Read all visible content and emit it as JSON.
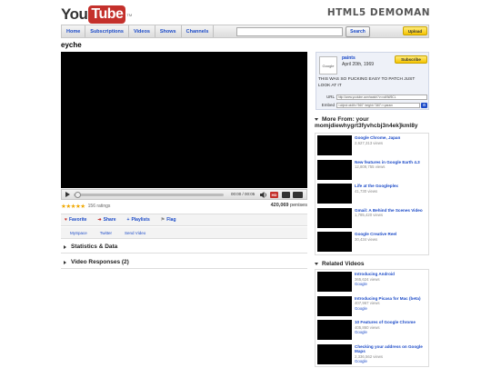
{
  "header": {
    "logo_you": "You",
    "logo_tube": "Tube",
    "logo_tm": "TM",
    "demo_title": "HTML5 DEMOMAN"
  },
  "nav": {
    "items": [
      "Home",
      "Subscriptions",
      "Videos",
      "Shows",
      "Channels"
    ],
    "search_button": "Search",
    "upload_button": "Upload"
  },
  "video": {
    "title": "eyche",
    "time": "00:00 / 00:05",
    "hd_label": "HD",
    "ratings": "156 ratings",
    "stars": "★★★★★",
    "view_count": "420,069",
    "view_suffix": "penises"
  },
  "actions": [
    "Favorite",
    "Share",
    "Playlists",
    "Flag"
  ],
  "share_links": [
    "MySpace",
    "Twitter",
    "Send Video"
  ],
  "sections": [
    "Statistics & Data",
    "Video Responses (2)"
  ],
  "channel": {
    "avatar_text": "Google",
    "uploader": "paints",
    "date": "April 20th, 1969",
    "subscribe": "Subscribe",
    "description": "THIS WAS SO FUCKING EASY TO PATCH JUST LOOK AT IT",
    "url_label": "URL",
    "url_value": "http://www.youtube.com/watch?v=xoiNW5CL",
    "embed_label": "Embed",
    "embed_value": "<object width=\"560\" height=\"340\"><param"
  },
  "more_from": {
    "heading": "More From: your momjdiewhygrt3fyvhcbj3n4ek]kml8y",
    "items": [
      {
        "title": "Google Chrome, Japan",
        "views": "2,627,313 views"
      },
      {
        "title": "New features in Google Earth 4.3",
        "views": "12,809,755 views"
      },
      {
        "title": "Life at the Googleplex",
        "views": "41,730 views"
      },
      {
        "title": "Gmail: A Behind the Scenes Video",
        "views": "1,785,420 views"
      },
      {
        "title": "Google Creative Reel",
        "views": "30,434 views"
      }
    ]
  },
  "related": {
    "heading": "Related Videos",
    "items": [
      {
        "title": "Introducing Android",
        "views": "365,624 views",
        "user": "Google"
      },
      {
        "title": "Introducing Picasa for Mac (beta)",
        "views": "407,967 views",
        "user": "Google"
      },
      {
        "title": "10 Features of Google Chrome",
        "views": "405,860 views",
        "user": "Google"
      },
      {
        "title": "Checking your address on Google Maps",
        "views": "2,336,562 views",
        "user": "Google"
      }
    ]
  }
}
